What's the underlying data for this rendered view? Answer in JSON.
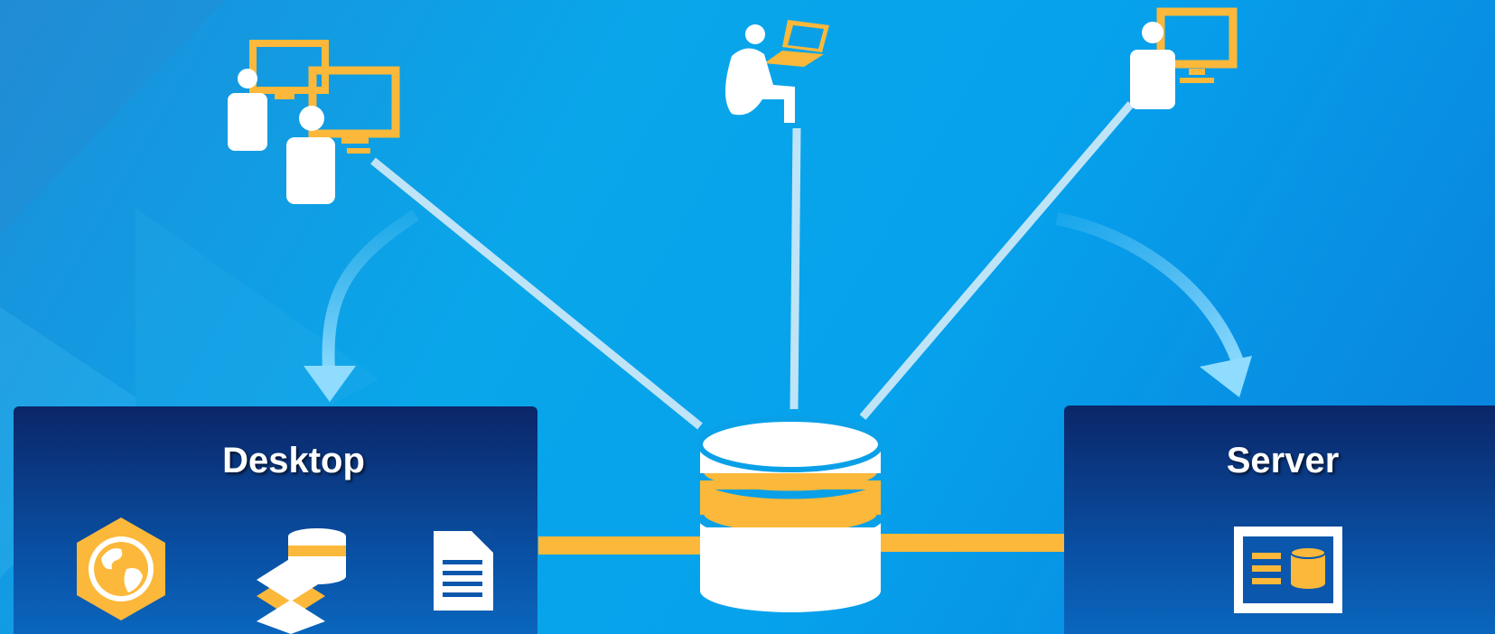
{
  "desktop": {
    "title": "Desktop",
    "icons": [
      "arcgis-pro-globe-icon",
      "layers-database-icon",
      "document-icon"
    ]
  },
  "server": {
    "title": "Server",
    "icons": [
      "server-database-icon"
    ]
  },
  "center": {
    "icon": "geodatabase-icon"
  },
  "users": [
    "user-group-desktops-icon",
    "user-laptop-icon",
    "user-desktop-icon"
  ],
  "colors": {
    "accent": "#fbb83a",
    "panel_top": "#0b2668",
    "panel_bottom": "#0a6ac2",
    "connector": "#bfe4f7",
    "arrow": "#7dd3f8"
  }
}
